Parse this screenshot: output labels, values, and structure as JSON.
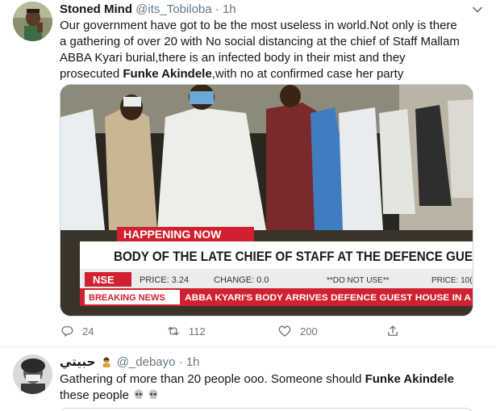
{
  "tweets": [
    {
      "display_name": "Stoned Mind",
      "handle": "@its_Tobiloba",
      "dot": "·",
      "time": "1h",
      "text_parts": {
        "a": "Our government have got to be the most useless in world.Not only is there a gathering of over 20 with No social distancing at the chief of Staff Mallam ABBA Kyari burial,there is an infected body in their mist and they prosecuted ",
        "b": "Funke Akindele",
        "c": ",with no at confirmed case her party"
      },
      "media": {
        "banner_top": "HAPPENING NOW",
        "headline": "BODY OF THE LATE CHIEF OF STAFF AT THE DEFENCE GUE",
        "ticker_nse": "NSE",
        "ticker_price": "PRICE: 3.24",
        "ticker_change": "CHANGE: 0.0",
        "ticker_note": "**DO NOT USE**",
        "ticker_price2": "PRICE: 10(",
        "breaking_label": "BREAKING NEWS",
        "breaking_text": "ABBA KYARI'S BODY ARRIVES DEFENCE GUEST HOUSE IN A"
      },
      "stats": {
        "replies": "24",
        "retweets": "112",
        "likes": "200"
      }
    },
    {
      "display_name": "حبيتي",
      "handle": "@_debayo",
      "dot": "·",
      "time": "1h",
      "text_parts": {
        "a": "Gathering of more than 20 people ooo. Someone should ",
        "b": "Funke Akindele",
        "c": " these people"
      }
    }
  ],
  "colors": {
    "text": "#14171a",
    "muted": "#657786",
    "border": "#e6ecf0",
    "news_red": "#d1202f"
  },
  "icons": [
    "reply-icon",
    "retweet-icon",
    "like-icon",
    "share-icon",
    "caret-down-icon",
    "skull-emoji"
  ]
}
